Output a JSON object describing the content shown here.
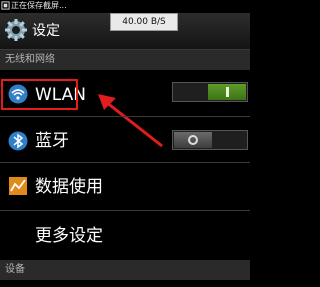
{
  "status_bar": {
    "text": "正在保存截屏...",
    "icon": "screenshot-icon"
  },
  "header": {
    "title": "设定",
    "icon": "gear-icon",
    "speed": "40.00 B/S"
  },
  "sections": {
    "wireless": "无线和网络",
    "device": "设备"
  },
  "rows": [
    {
      "label": "WLAN",
      "icon": "wifi-icon",
      "toggle": "on"
    },
    {
      "label": "蓝牙",
      "icon": "bluetooth-icon",
      "toggle": "off"
    },
    {
      "label": "数据使用",
      "icon": "data-usage-icon"
    },
    {
      "label": "更多设定"
    }
  ],
  "colors": {
    "highlight": "#e11c1c",
    "toggle_on": "#4e8a1f"
  }
}
